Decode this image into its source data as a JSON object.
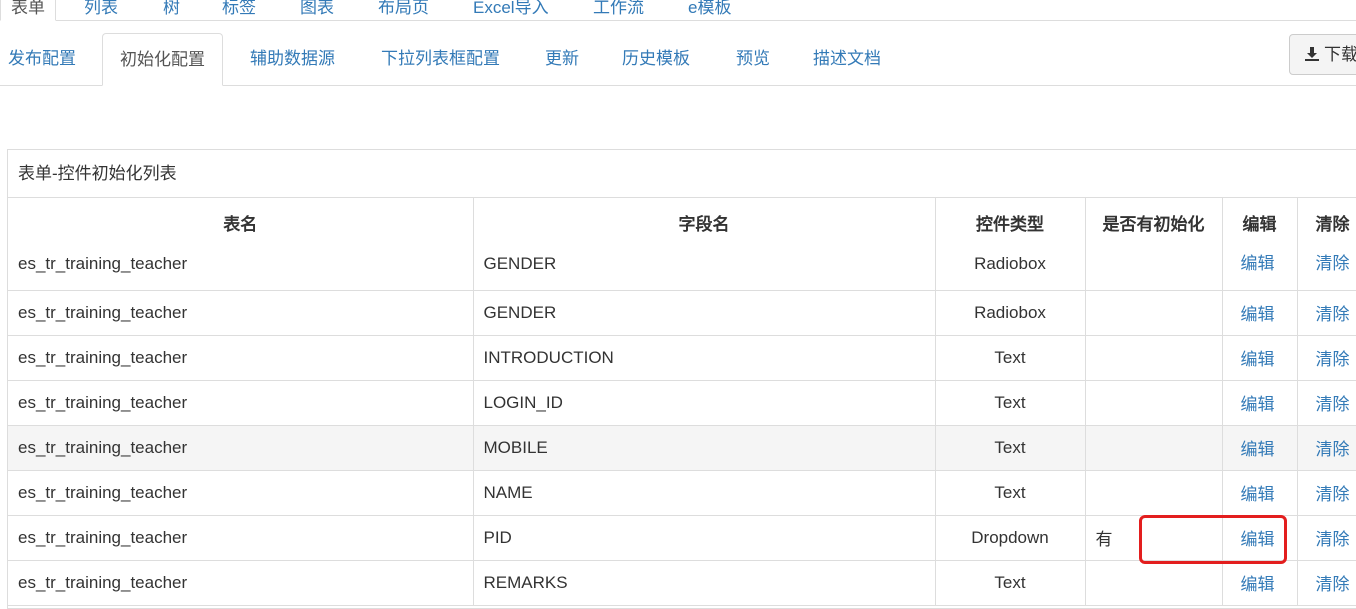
{
  "top_tabs": [
    "表单",
    "列表",
    "树",
    "标签",
    "图表",
    "布局页",
    "Excel导入",
    "工作流",
    "e模板"
  ],
  "sub_tabs": [
    "发布配置",
    "初始化配置",
    "辅助数据源",
    "下拉列表框配置",
    "更新",
    "历史模板",
    "预览",
    "描述文档"
  ],
  "download_label": "下载",
  "panel_title": "表单-控件初始化列表",
  "columns": [
    "表名",
    "字段名",
    "控件类型",
    "是否有初始化",
    "编辑",
    "清除"
  ],
  "rows": [
    {
      "table": "es_tr_training_teacher",
      "field": "GENDER",
      "type": "Radiobox",
      "init": "",
      "edit": "编辑",
      "clear": "清除"
    },
    {
      "table": "es_tr_training_teacher",
      "field": "GENDER",
      "type": "Radiobox",
      "init": "",
      "edit": "编辑",
      "clear": "清除"
    },
    {
      "table": "es_tr_training_teacher",
      "field": "INTRODUCTION",
      "type": "Text",
      "init": "",
      "edit": "编辑",
      "clear": "清除"
    },
    {
      "table": "es_tr_training_teacher",
      "field": "LOGIN_ID",
      "type": "Text",
      "init": "",
      "edit": "编辑",
      "clear": "清除"
    },
    {
      "table": "es_tr_training_teacher",
      "field": "MOBILE",
      "type": "Text",
      "init": "",
      "edit": "编辑",
      "clear": "清除"
    },
    {
      "table": "es_tr_training_teacher",
      "field": "NAME",
      "type": "Text",
      "init": "",
      "edit": "编辑",
      "clear": "清除"
    },
    {
      "table": "es_tr_training_teacher",
      "field": "PID",
      "type": "Dropdown",
      "init": "有",
      "edit": "编辑",
      "clear": "清除"
    },
    {
      "table": "es_tr_training_teacher",
      "field": "REMARKS",
      "type": "Text",
      "init": "",
      "edit": "编辑",
      "clear": "清除"
    }
  ],
  "colors": {
    "link": "#337ab7",
    "highlight": "#e31e1e",
    "border": "#dddddd"
  }
}
